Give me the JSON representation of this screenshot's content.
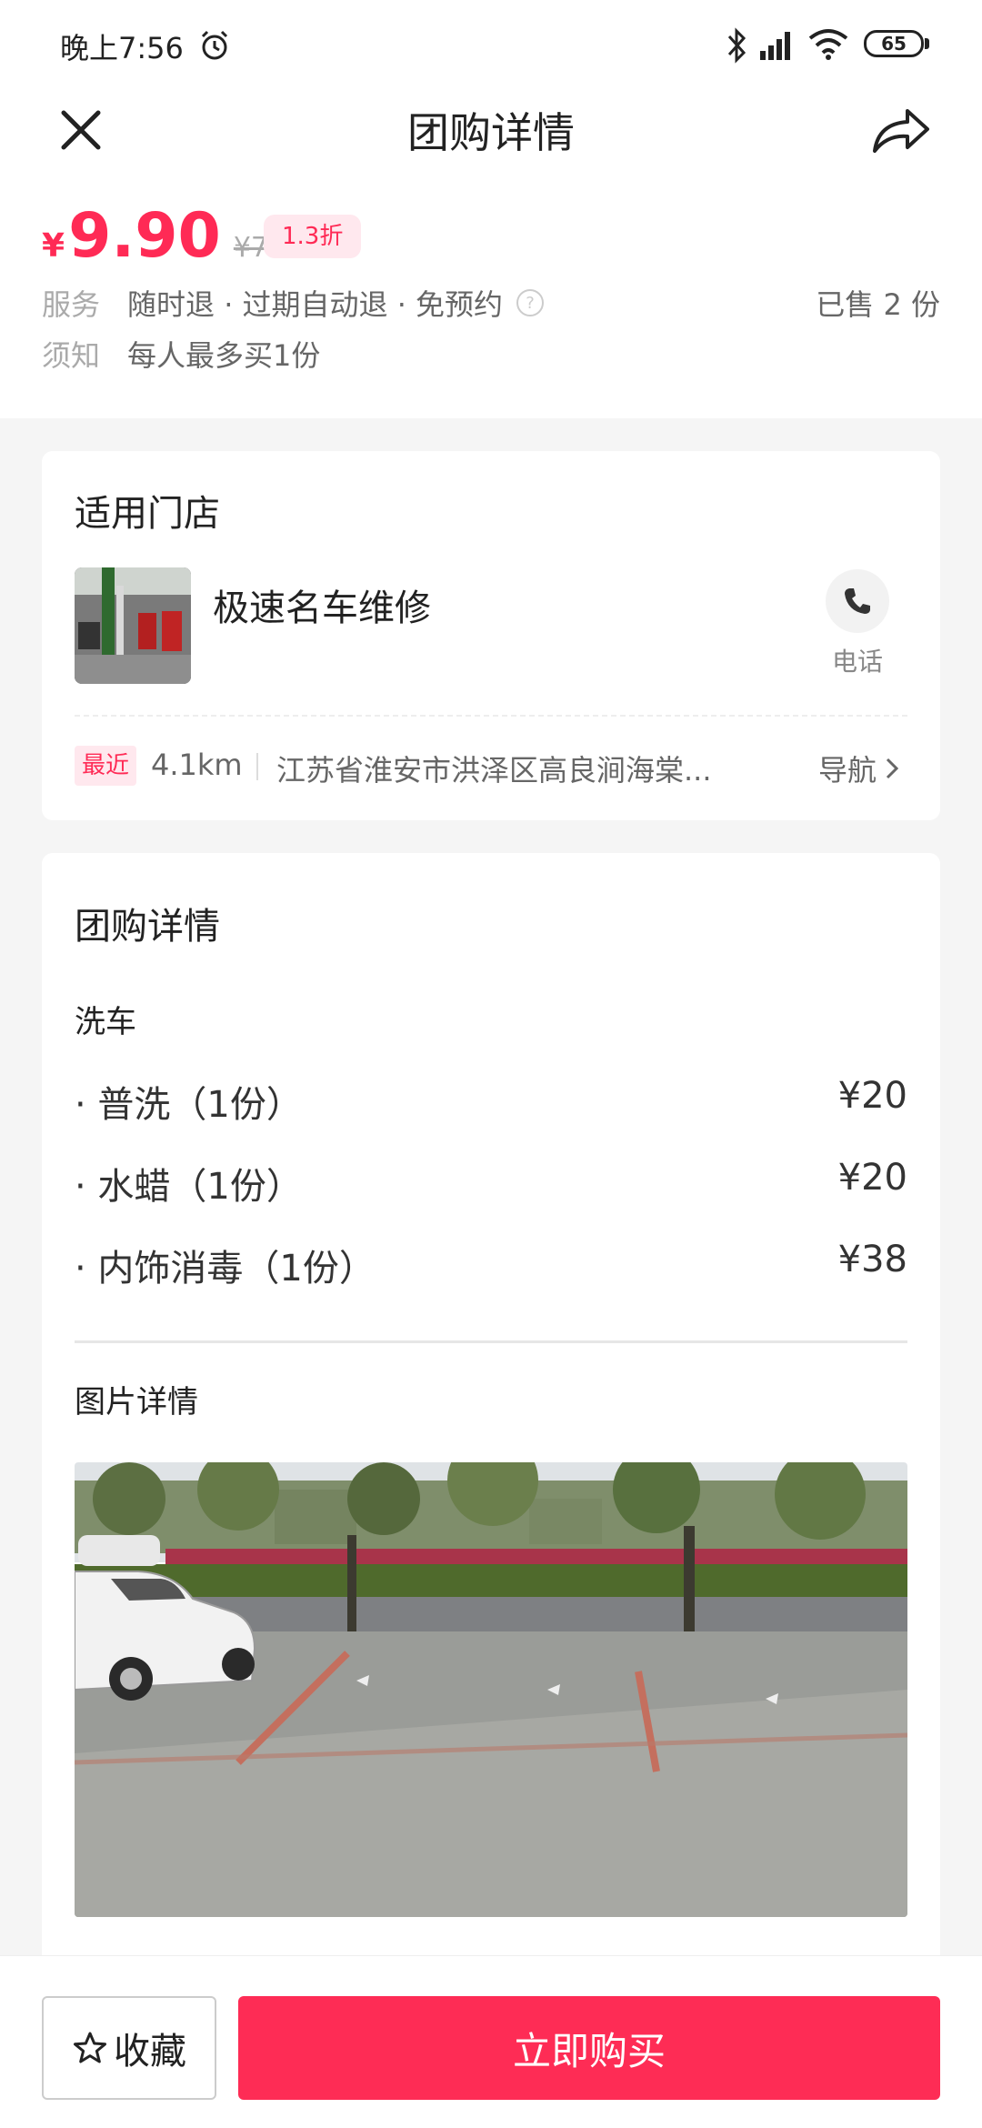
{
  "status_bar": {
    "time": "晚上7:56",
    "battery": "65",
    "icons": [
      "alarm-icon",
      "bluetooth-icon",
      "signal-icon",
      "wifi-icon",
      "battery-icon"
    ]
  },
  "header": {
    "title": "团购详情",
    "close_icon": "close-icon",
    "share_icon": "share-icon"
  },
  "price": {
    "symbol": "¥",
    "value": "9.90",
    "original": "¥78",
    "discount": "1.3折",
    "service_label": "服务",
    "service_text": "随时退 · 过期自动退 · 免预约",
    "notice_label": "须知",
    "notice_text": "每人最多买1份",
    "sold": "已售 2 份"
  },
  "stores": {
    "title": "适用门店",
    "store_name": "极速名车维修",
    "phone_label": "电话",
    "nearest_badge": "最近",
    "distance": "4.1km",
    "address": "江苏省淮安市洪泽区高良涧海棠...",
    "nav_label": "导航"
  },
  "details": {
    "title": "团购详情",
    "category": "洗车",
    "items": [
      {
        "name": "· 普洗（1份）",
        "price": "¥20"
      },
      {
        "name": "· 水蜡（1份）",
        "price": "¥20"
      },
      {
        "name": "· 内饰消毒（1份）",
        "price": "¥38"
      }
    ],
    "photo_title": "图片详情"
  },
  "bottom": {
    "favorite_label": "收藏",
    "buy_label": "立即购买"
  },
  "colors": {
    "accent": "#fe2c55",
    "badge_bg": "#ffe8ee"
  }
}
